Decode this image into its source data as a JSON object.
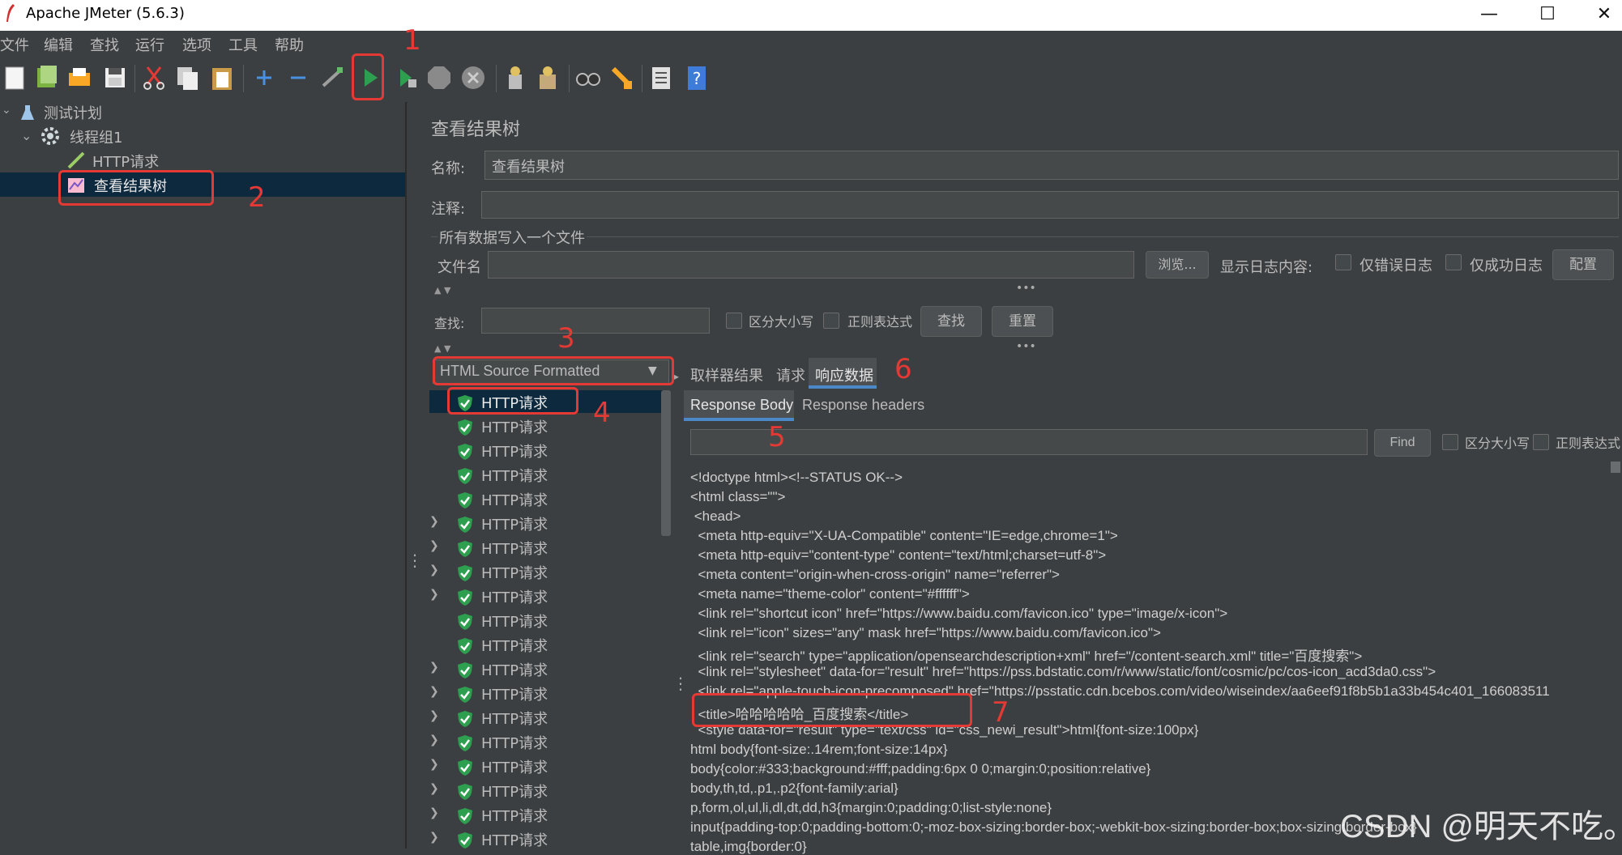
{
  "window": {
    "title": "Apache JMeter (5.6.3)",
    "minimize": "—",
    "maximize": "☐",
    "close": "✕"
  },
  "menu": [
    "文件",
    "编辑",
    "查找",
    "运行",
    "选项",
    "工具",
    "帮助"
  ],
  "toolbar": {
    "icons": [
      "new-icon",
      "templates-icon",
      "open-icon",
      "save-icon",
      "cut-icon",
      "copy-icon",
      "paste-icon",
      "expand-icon",
      "collapse-icon",
      "toggle-icon",
      "start-icon",
      "start-no-pause-icon",
      "stop-icon",
      "shutdown-icon",
      "clear-icon",
      "clear-all-icon",
      "search-icon",
      "reset-search-icon",
      "function-helper-icon",
      "help-icon"
    ]
  },
  "tree": {
    "test_plan": "测试计划",
    "thread_group": "线程组1",
    "http_request": "HTTP请求",
    "view_results_tree": "查看结果树"
  },
  "panel": {
    "title": "查看结果树",
    "name_label": "名称:",
    "name_value": "查看结果树",
    "comment_label": "注释:",
    "file_section": "所有数据写入一个文件",
    "filename_label": "文件名",
    "browse": "浏览...",
    "log_label": "显示日志内容:",
    "errors_only": "仅错误日志",
    "success_only": "仅成功日志",
    "config": "配置",
    "search_label": "查找:",
    "case_sensitive": "区分大小写",
    "regex": "正则表达式",
    "find_btn": "查找",
    "reset_btn": "重置"
  },
  "renderer": {
    "selected": "HTML Source Formatted"
  },
  "results": {
    "items": [
      {
        "label": "HTTP请求",
        "expandable": false
      },
      {
        "label": "HTTP请求",
        "expandable": false
      },
      {
        "label": "HTTP请求",
        "expandable": false
      },
      {
        "label": "HTTP请求",
        "expandable": false
      },
      {
        "label": "HTTP请求",
        "expandable": false
      },
      {
        "label": "HTTP请求",
        "expandable": true
      },
      {
        "label": "HTTP请求",
        "expandable": true
      },
      {
        "label": "HTTP请求",
        "expandable": true
      },
      {
        "label": "HTTP请求",
        "expandable": true
      },
      {
        "label": "HTTP请求",
        "expandable": false
      },
      {
        "label": "HTTP请求",
        "expandable": false
      },
      {
        "label": "HTTP请求",
        "expandable": true
      },
      {
        "label": "HTTP请求",
        "expandable": true
      },
      {
        "label": "HTTP请求",
        "expandable": true
      },
      {
        "label": "HTTP请求",
        "expandable": true
      },
      {
        "label": "HTTP请求",
        "expandable": true
      },
      {
        "label": "HTTP请求",
        "expandable": true
      },
      {
        "label": "HTTP请求",
        "expandable": true
      },
      {
        "label": "HTTP请求",
        "expandable": true
      }
    ]
  },
  "tabs": {
    "sampler_result": "取样器结果",
    "request": "请求",
    "response_data": "响应数据"
  },
  "subtabs": {
    "response_body": "Response Body",
    "response_headers": "Response headers"
  },
  "find": {
    "button": "Find",
    "case_sensitive": "区分大小写",
    "regex": "正则表达式"
  },
  "response_lines": [
    "<!doctype html><!--STATUS OK-->",
    "<html class=\"\">",
    " <head>",
    "  <meta http-equiv=\"X-UA-Compatible\" content=\"IE=edge,chrome=1\">",
    "  <meta http-equiv=\"content-type\" content=\"text/html;charset=utf-8\">",
    "  <meta content=\"origin-when-cross-origin\" name=\"referrer\">",
    "  <meta name=\"theme-color\" content=\"#ffffff\">",
    "  <link rel=\"shortcut icon\" href=\"https://www.baidu.com/favicon.ico\" type=\"image/x-icon\">",
    "  <link rel=\"icon\" sizes=\"any\" mask href=\"https://www.baidu.com/favicon.ico\">",
    "  <link rel=\"search\" type=\"application/opensearchdescription+xml\" href=\"/content-search.xml\" title=\"百度搜索\">",
    "  <link rel=\"stylesheet\" data-for=\"result\" href=\"https://pss.bdstatic.com/r/www/static/font/cosmic/pc/cos-icon_acd3da0.css\">",
    "  <link rel=\"apple-touch-icon-precomposed\" href=\"https://psstatic.cdn.bcebos.com/video/wiseindex/aa6eef91f8b5b1a33b454c401_166083511",
    "  <title>哈哈哈哈哈_百度搜索</title>",
    "  <style data-for=\"result\" type=\"text/css\" id=\"css_newi_result\">html{font-size:100px}",
    "html body{font-size:.14rem;font-size:14px}",
    "body{color:#333;background:#fff;padding:6px 0 0;margin:0;position:relative}",
    "body,th,td,.p1,.p2{font-family:arial}",
    "p,form,ol,ul,li,dl,dt,dd,h3{margin:0;padding:0;list-style:none}",
    "input{padding-top:0;padding-bottom:0;-moz-box-sizing:border-box;-webkit-box-sizing:border-box;box-sizing:border-box}",
    "table,img{border:0}"
  ],
  "annotations": [
    "1",
    "2",
    "3",
    "4",
    "5",
    "6",
    "7"
  ],
  "watermark": "CSDN @明天不吃。",
  "colors": {
    "accent_red": "#e53935",
    "bg": "#3c3f41",
    "selected_row": "#0d293e",
    "success_green": "#2e9e4f"
  }
}
